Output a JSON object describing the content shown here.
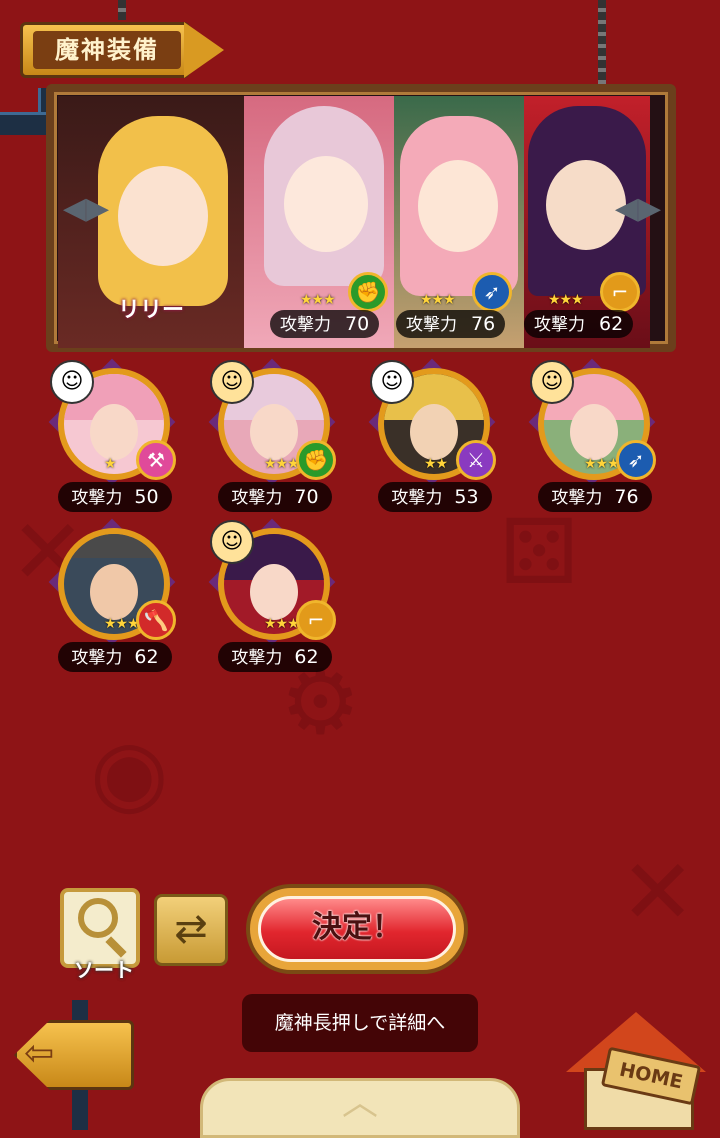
{
  "screen_title": "魔神装備",
  "party": {
    "leader_name": "リリー",
    "slots": [
      {
        "stars": "★★★",
        "atk_label": "攻撃力",
        "atk": "70",
        "type": "fist",
        "type_color": "#2a9a2a",
        "type_glyph": "✊"
      },
      {
        "stars": "★★★",
        "atk_label": "攻撃力",
        "atk": "76",
        "type": "bow",
        "type_color": "#1c5cb0",
        "type_glyph": "➶"
      },
      {
        "stars": "★★★",
        "atk_label": "攻撃力",
        "atk": "62",
        "type": "gun",
        "type_color": "#e29a1a",
        "type_glyph": "⌐"
      }
    ]
  },
  "roster": [
    {
      "leader_icon": "boy",
      "stars": "★",
      "atk_label": "攻撃力",
      "atk": "50",
      "type": "hammer",
      "type_color": "#e04a9a",
      "type_glyph": "⚒"
    },
    {
      "leader_icon": "girl",
      "stars": "★★★",
      "atk_label": "攻撃力",
      "atk": "70",
      "type": "fist",
      "type_color": "#2a9a2a",
      "type_glyph": "✊"
    },
    {
      "leader_icon": "boy",
      "stars": "★★",
      "atk_label": "攻撃力",
      "atk": "53",
      "type": "sword",
      "type_color": "#8a3ac0",
      "type_glyph": "⚔"
    },
    {
      "leader_icon": "girl",
      "stars": "★★★",
      "atk_label": "攻撃力",
      "atk": "76",
      "type": "bow",
      "type_color": "#1c5cb0",
      "type_glyph": "➶"
    },
    {
      "leader_icon": "",
      "stars": "★★★",
      "atk_label": "攻撃力",
      "atk": "62",
      "type": "axe",
      "type_color": "#d22a2a",
      "type_glyph": "🪓"
    },
    {
      "leader_icon": "girl",
      "stars": "★★★★",
      "atk_label": "攻撃力",
      "atk": "62",
      "type": "gun",
      "type_color": "#e29a1a",
      "type_glyph": "⌐"
    }
  ],
  "buttons": {
    "sort_label": "ソート",
    "confirm_label": "決定！",
    "refresh_glyph": "⇄",
    "back_glyph": "⇦",
    "home_label": "HOME"
  },
  "tip": "魔神長押しで詳細へ",
  "nav": {
    "left_glyph": "◀▶",
    "right_glyph": "◀▶"
  }
}
